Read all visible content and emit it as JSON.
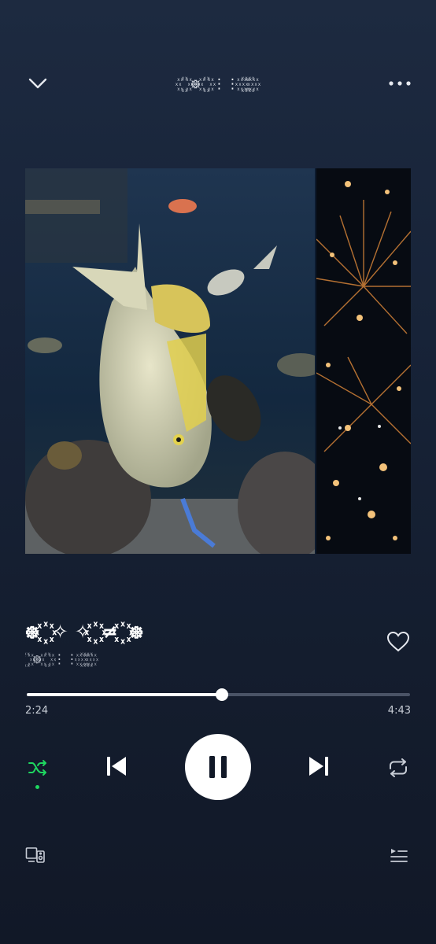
{
  "header": {
    "title": "꙰ ꙰ ᪥ ꙰ ꙰ ⋮⋮ ꙰ ꙰ ꙰ ꙰",
    "collapse_icon": "chevron-down-icon",
    "more_icon": "more-horizontal-icon"
  },
  "artwork": {
    "panels": [
      "aquarium fish photo",
      "fireworks photo"
    ]
  },
  "track": {
    "title": "᪥ ꙰ ✧ ✧ ꙰ ≠ ꙰ ᪥",
    "artist": "꙰ ꙰ ᪥ ꙰ ꙰ ⋮⋮ ꙰ ꙰ ꙰ ꙰",
    "liked": false
  },
  "playback": {
    "elapsed": "2:24",
    "duration": "4:43",
    "progress": 0.509,
    "is_playing": true,
    "shuffle_on": true,
    "repeat_mode": "off"
  },
  "colors": {
    "accent": "#1ed760",
    "background_top": "#1d2a40",
    "background_bottom": "#111827"
  },
  "footer": {
    "devices_icon": "connect-devices-icon",
    "queue_icon": "queue-icon"
  }
}
